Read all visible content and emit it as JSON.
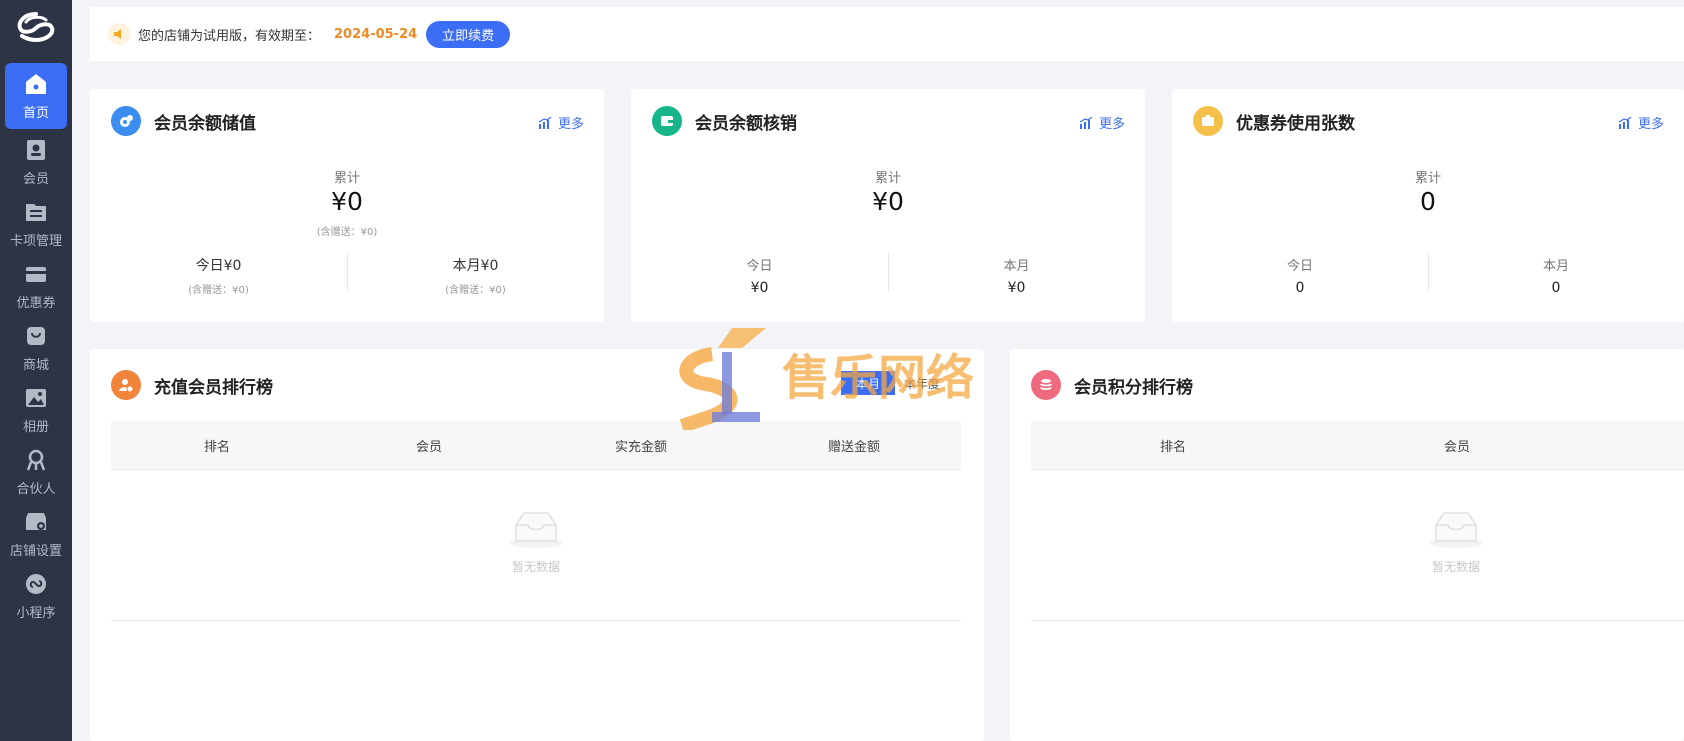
{
  "sidebar": {
    "items": [
      {
        "label": "首页",
        "icon": "home-icon",
        "active": true
      },
      {
        "label": "会员",
        "icon": "member-icon"
      },
      {
        "label": "卡项管理",
        "icon": "card-icon"
      },
      {
        "label": "优惠券",
        "icon": "coupon-icon"
      },
      {
        "label": "商城",
        "icon": "shop-icon"
      },
      {
        "label": "相册",
        "icon": "album-icon"
      },
      {
        "label": "合伙人",
        "icon": "partner-icon"
      },
      {
        "label": "店铺设置",
        "icon": "store-settings-icon"
      },
      {
        "label": "小程序",
        "icon": "mini-program-icon"
      }
    ]
  },
  "banner": {
    "text": "您的店铺为试用版，有效期至：",
    "date": "2024-05-24",
    "button": "立即续费"
  },
  "cards": [
    {
      "title": "会员余额储值",
      "more": "更多",
      "total_label": "累计",
      "total_value": "¥0",
      "total_note": "(含赠送：¥0)",
      "today": "今日¥0",
      "today_note": "(含赠送：¥0)",
      "month": "本月¥0",
      "month_note": "(含赠送：¥0)",
      "color": "#3b8df0"
    },
    {
      "title": "会员余额核销",
      "more": "更多",
      "total_label": "累计",
      "total_value": "¥0",
      "today_label": "今日",
      "today_value": "¥0",
      "month_label": "本月",
      "month_value": "¥0",
      "color": "#17b58a"
    },
    {
      "title": "优惠券使用张数",
      "more": "更多",
      "total_label": "累计",
      "total_value": "0",
      "today_label": "今日",
      "today_value": "0",
      "month_label": "本月",
      "month_value": "0",
      "color": "#f5c04a"
    }
  ],
  "recharge_rank": {
    "title": "充值会员排行榜",
    "tabs": [
      "本月",
      "本年度"
    ],
    "columns": [
      "排名",
      "会员",
      "实充金额",
      "赠送金额"
    ],
    "empty": "暂无数据",
    "color": "#f0843a"
  },
  "points_rank": {
    "title": "会员积分排行榜",
    "columns": [
      "排名",
      "会员"
    ],
    "empty": "暂无数据",
    "color": "#f06a7f"
  },
  "watermark": "售乐网络"
}
